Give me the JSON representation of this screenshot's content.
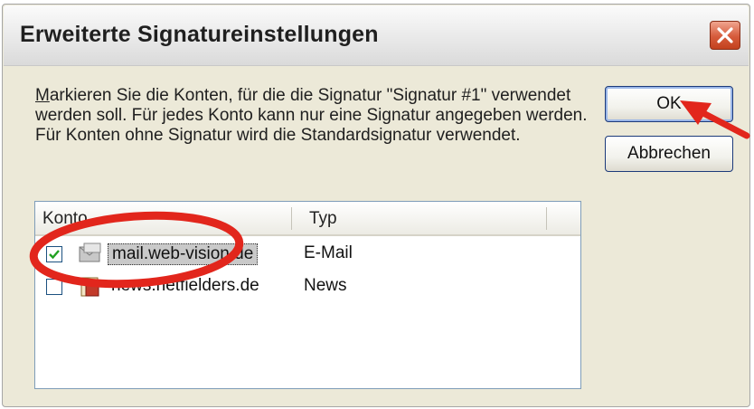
{
  "dialog": {
    "title": "Erweiterte Signatureinstellungen",
    "message_accel": "M",
    "message_rest": "arkieren Sie die Konten, für die die Signatur \"Signatur #1\" verwendet werden soll. Für jedes Konto kann nur eine Signatur angegeben werden. Für Konten ohne Signatur wird die Standardsignatur verwendet."
  },
  "buttons": {
    "ok": "OK",
    "cancel": "Abbrechen"
  },
  "list": {
    "columns": {
      "account": "Konto",
      "type": "Typ"
    },
    "rows": [
      {
        "name": "mail.web-vision.de",
        "type": "E-Mail",
        "checked": true,
        "selected": true
      },
      {
        "name": "news.netfielders.de",
        "type": "News",
        "checked": false,
        "selected": false
      }
    ]
  },
  "colors": {
    "annotation": "#e2261c",
    "dialog_bg": "#ece9d8",
    "close_button": "#d65b3b"
  },
  "icons": [
    "close-icon",
    "checkmark-icon",
    "mail-account-icon",
    "news-account-icon"
  ]
}
